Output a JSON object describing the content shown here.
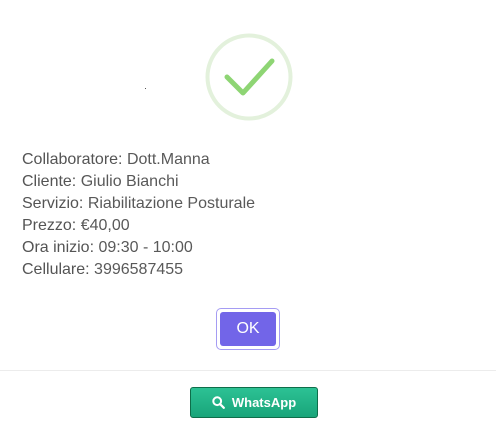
{
  "dialog": {
    "status_icon": "check-circle-icon",
    "details": [
      {
        "label": "Collaboratore:",
        "value": "Dott.Manna"
      },
      {
        "label": "Cliente:",
        "value": "Giulio Bianchi"
      },
      {
        "label": "Servizio:",
        "value": "Riabilitazione Posturale"
      },
      {
        "label": "Prezzo:",
        "value": "€40,00"
      },
      {
        "label": "Ora inizio:",
        "value": "09:30 - 10:00"
      },
      {
        "label": "Cellulare:",
        "value": "3996587455"
      }
    ],
    "ok_label": "OK"
  },
  "footer": {
    "whatsapp_label": "WhatsApp",
    "whatsapp_icon": "search-icon"
  },
  "colors": {
    "success_ring": "#e3f1dc",
    "success_check": "#8ed574",
    "ok_button": "#7265e8",
    "whatsapp_button": "#1fae83"
  }
}
